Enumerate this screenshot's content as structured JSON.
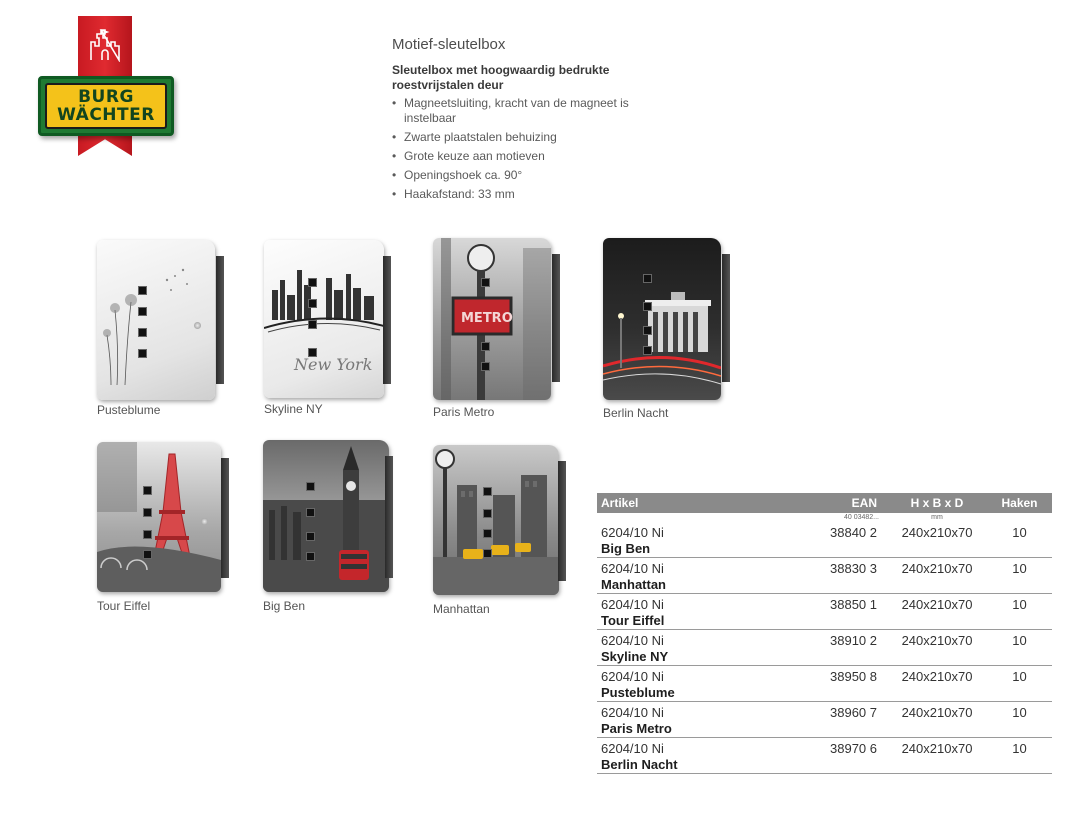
{
  "brand": {
    "line1": "BURG",
    "line2": "WÄCHTER"
  },
  "description": {
    "title": "Motief-sleutelbox",
    "subtitle": "Sleutelbox met hoogwaardig bedrukte roestvrijstalen deur",
    "features": [
      "Magneetsluiting, kracht van de magneet is instelbaar",
      "Zwarte plaatstalen behuizing",
      "Grote keuze aan motieven",
      "Openingshoek ca. 90°",
      "Haakafstand: 33 mm"
    ]
  },
  "products": [
    {
      "name": "Pusteblume"
    },
    {
      "name": "Skyline NY"
    },
    {
      "name": "Paris Metro"
    },
    {
      "name": "Berlin Nacht"
    },
    {
      "name": "Tour Eiffel"
    },
    {
      "name": "Big Ben"
    },
    {
      "name": "Manhattan"
    }
  ],
  "table": {
    "headers": [
      "Artikel",
      "EAN",
      "H x B x D",
      "Haken"
    ],
    "units": [
      "",
      "40 03482...",
      "mm",
      ""
    ],
    "rows": [
      {
        "article": "6204/10 Ni",
        "motif": "Big Ben",
        "ean": "38840 2",
        "dims": "240x210x70",
        "hooks": "10"
      },
      {
        "article": "6204/10 Ni",
        "motif": "Manhattan",
        "ean": "38830 3",
        "dims": "240x210x70",
        "hooks": "10"
      },
      {
        "article": "6204/10 Ni",
        "motif": "Tour Eiffel",
        "ean": "38850 1",
        "dims": "240x210x70",
        "hooks": "10"
      },
      {
        "article": "6204/10 Ni",
        "motif": "Skyline NY",
        "ean": "38910 2",
        "dims": "240x210x70",
        "hooks": "10"
      },
      {
        "article": "6204/10 Ni",
        "motif": "Pusteblume",
        "ean": "38950 8",
        "dims": "240x210x70",
        "hooks": "10"
      },
      {
        "article": "6204/10 Ni",
        "motif": "Paris Metro",
        "ean": "38960 7",
        "dims": "240x210x70",
        "hooks": "10"
      },
      {
        "article": "6204/10 Ni",
        "motif": "Berlin Nacht",
        "ean": "38970 6",
        "dims": "240x210x70",
        "hooks": "10"
      }
    ]
  }
}
